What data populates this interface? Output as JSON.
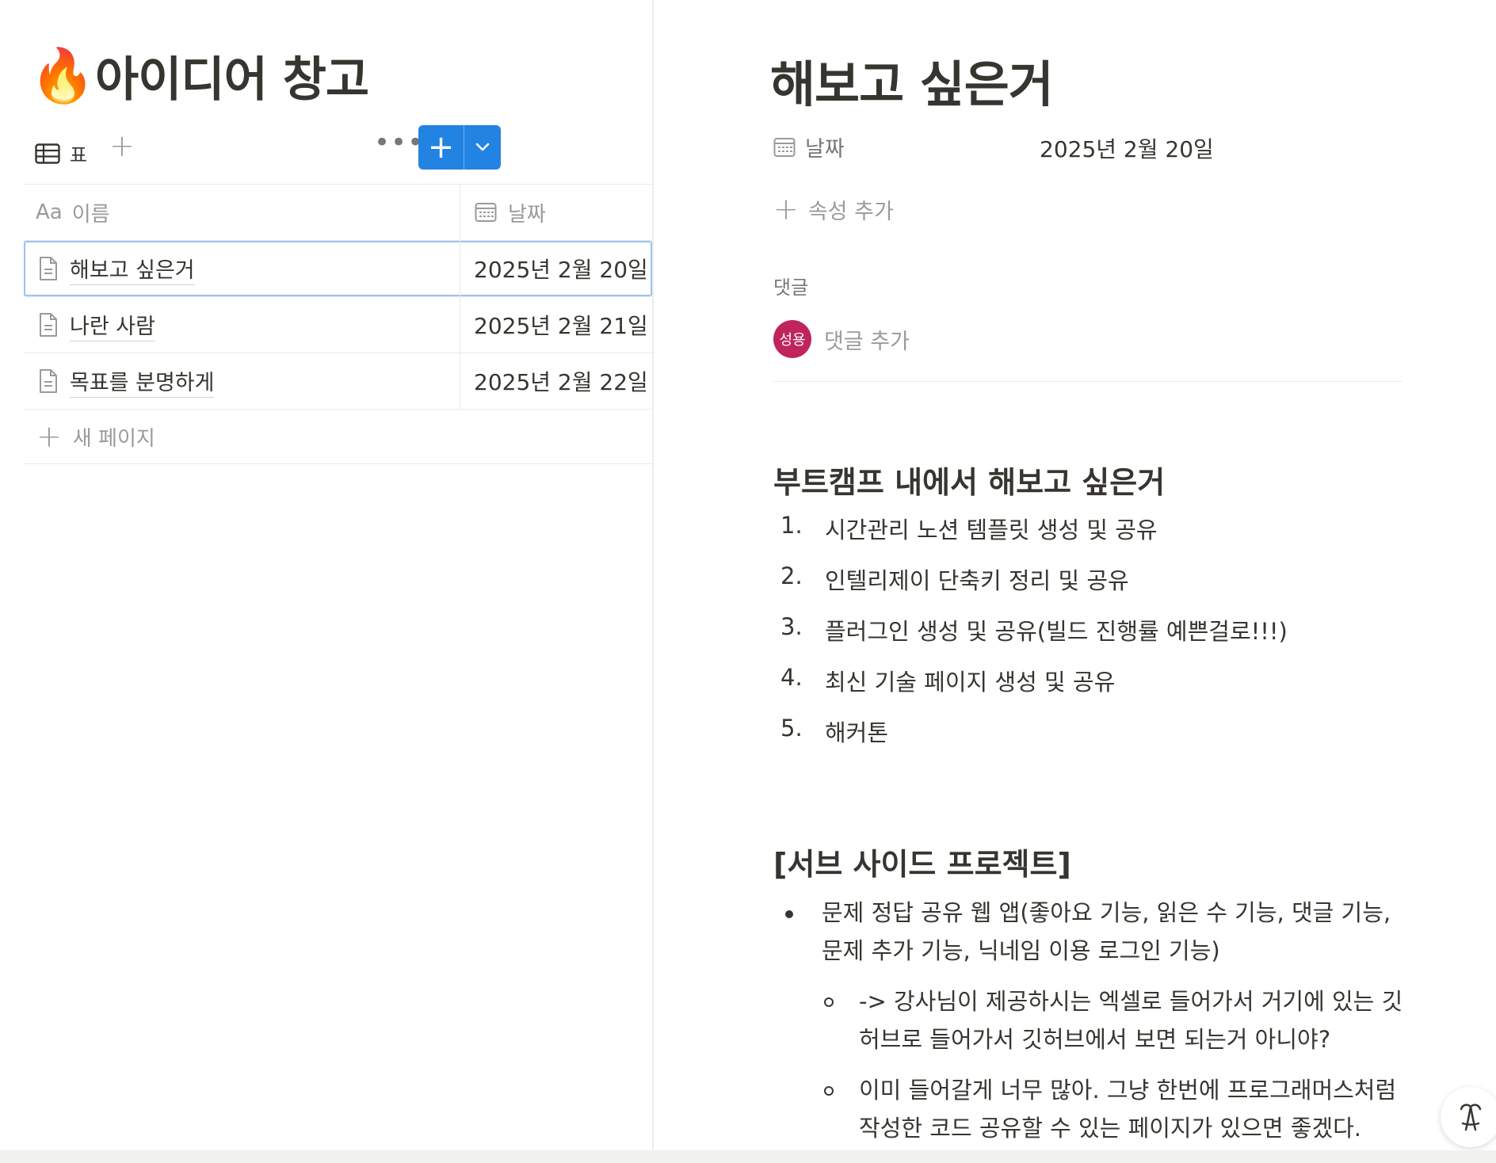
{
  "database": {
    "icon": "fire-emoji",
    "emoji": "🔥",
    "title": "아이디어 창고",
    "view_label": "표",
    "add_view": "+",
    "more": "•••",
    "new_button": "+",
    "columns": {
      "name": "이름",
      "name_prefix": "Aa",
      "date": "날짜"
    },
    "rows": [
      {
        "title": "해보고 싶은거",
        "date": "2025년 2월 20일",
        "selected": true
      },
      {
        "title": "나란 사람",
        "date": "2025년 2월 21일",
        "selected": false
      },
      {
        "title": "목표를 분명하게",
        "date": "2025년 2월 22일",
        "selected": false
      }
    ],
    "new_page": "새 페이지"
  },
  "page": {
    "title": "해보고 싶은거",
    "property": {
      "label": "날짜",
      "value": "2025년 2월 20일"
    },
    "add_property": "속성 추가",
    "comments": {
      "label": "댓글",
      "avatar": "성용",
      "placeholder": "댓글 추가"
    },
    "section1": {
      "heading": "부트캠프 내에서 해보고 싶은거",
      "items": [
        "시간관리 노션 템플릿 생성 및 공유",
        "인텔리제이 단축키 정리 및 공유",
        "플러그인 생성 및 공유(빌드 진행률 예쁜걸로!!!)",
        "최신 기술 페이지 생성 및 공유",
        "해커톤"
      ]
    },
    "section2": {
      "heading": "[서브 사이드 프로젝트]",
      "bullet": "문제 정답 공유 웹 앱(좋아요 기능, 읽은 수 기능, 댓글 기능, 문제 추가 기능, 닉네임 이용 로그인 기능)",
      "sub1": "-> 강사님이 제공하시는 엑셀로 들어가서 거기에 있는 깃허브로 들어가서 깃허브에서 보면 되는거 아니야?",
      "sub2": "이미 들어갈게 너무 많아. 그냥 한번에 프로그래머스처럼 작성한 코드 공유할 수 있는 페이지가 있으면 좋겠다."
    }
  },
  "help_button": "?",
  "colors": {
    "accent": "#2383e2",
    "avatar": "#c0245c",
    "text": "#37352f",
    "muted": "#9b9a97"
  }
}
